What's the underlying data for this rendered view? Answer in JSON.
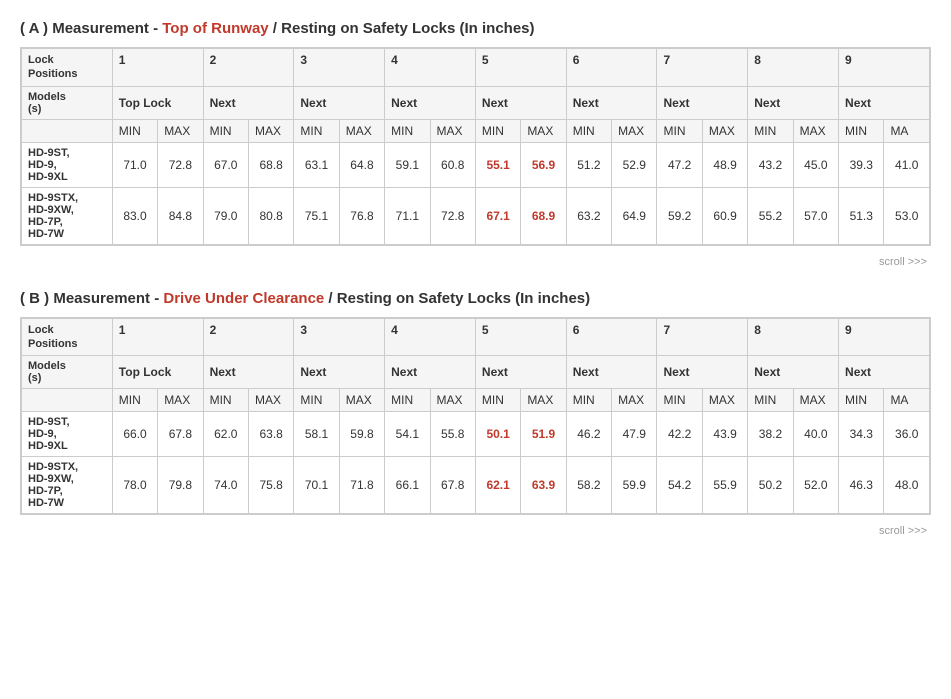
{
  "sectionA": {
    "title_prefix": "( A ) Measurement - ",
    "title_highlight": "Top of Runway",
    "title_suffix": " / Resting on Safety Locks (In inches)",
    "scroll_label": "scroll >>>",
    "lock_positions_label": "Lock\nPositions",
    "models_label": "Models\n(s)",
    "positions": [
      "1",
      "2",
      "3",
      "4",
      "5",
      "6",
      "7",
      "8",
      "9"
    ],
    "col_labels": {
      "top_lock": "Top Lock",
      "next": "Next"
    },
    "min_label": "MIN",
    "max_label": "MAX",
    "rows": [
      {
        "model": "HD-9ST,\nHD-9,\nHD-9XL",
        "values": [
          71.0,
          72.8,
          67.0,
          68.8,
          63.1,
          64.8,
          59.1,
          60.8,
          55.1,
          56.9,
          51.2,
          52.9,
          47.2,
          48.9,
          43.2,
          45.0,
          39.3,
          41.0
        ],
        "red_indices": [
          8,
          9
        ]
      },
      {
        "model": "HD-9STX,\nHD-9XW,\nHD-7P,\nHD-7W",
        "values": [
          83.0,
          84.8,
          79.0,
          80.8,
          75.1,
          76.8,
          71.1,
          72.8,
          67.1,
          68.9,
          63.2,
          64.9,
          59.2,
          60.9,
          55.2,
          57.0,
          51.3,
          53.0
        ],
        "red_indices": [
          8,
          9
        ]
      }
    ]
  },
  "sectionB": {
    "title_prefix": "( B ) Measurement - ",
    "title_highlight": "Drive Under Clearance",
    "title_suffix": " / Resting on Safety Locks (In inches)",
    "scroll_label": "scroll >>>",
    "lock_positions_label": "Lock\nPositions",
    "models_label": "Models\n(s)",
    "positions": [
      "1",
      "2",
      "3",
      "4",
      "5",
      "6",
      "7",
      "8",
      "9"
    ],
    "col_labels": {
      "top_lock": "Top Lock",
      "next": "Next"
    },
    "min_label": "MIN",
    "max_label": "MAX",
    "rows": [
      {
        "model": "HD-9ST,\nHD-9,\nHD-9XL",
        "values": [
          66.0,
          67.8,
          62.0,
          63.8,
          58.1,
          59.8,
          54.1,
          55.8,
          50.1,
          51.9,
          46.2,
          47.9,
          42.2,
          43.9,
          38.2,
          40.0,
          34.3,
          36.0
        ],
        "red_indices": [
          8,
          9
        ]
      },
      {
        "model": "HD-9STX,\nHD-9XW,\nHD-7P,\nHD-7W",
        "values": [
          78.0,
          79.8,
          74.0,
          75.8,
          70.1,
          71.8,
          66.1,
          67.8,
          62.1,
          63.9,
          58.2,
          59.9,
          54.2,
          55.9,
          50.2,
          52.0,
          46.3,
          48.0
        ],
        "red_indices": [
          8,
          9
        ]
      }
    ]
  }
}
